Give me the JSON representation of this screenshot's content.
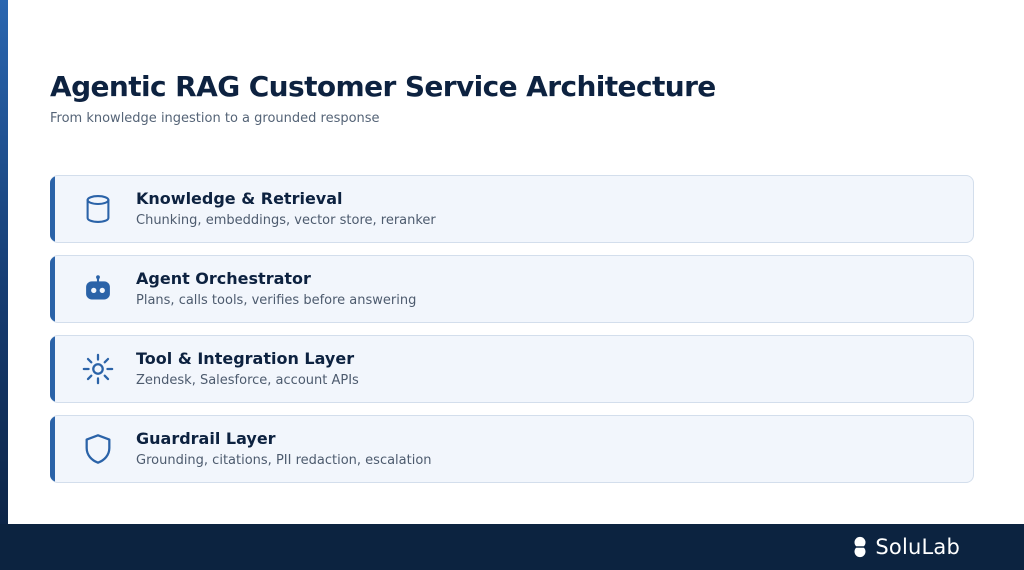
{
  "header": {
    "title": "Agentic RAG Customer Service Architecture",
    "subtitle": "From knowledge ingestion to a grounded response"
  },
  "layers": [
    {
      "title": "Knowledge & Retrieval",
      "description": "Chunking, embeddings, vector store, reranker",
      "icon": "database-icon"
    },
    {
      "title": "Agent Orchestrator",
      "description": "Plans, calls tools, verifies before answering",
      "icon": "robot-icon"
    },
    {
      "title": "Tool & Integration Layer",
      "description": "Zendesk, Salesforce, account APIs",
      "icon": "sun-gear-icon"
    },
    {
      "title": "Guardrail Layer",
      "description": "Grounding, citations, PII redaction, escalation",
      "icon": "shield-icon"
    }
  ],
  "footer": {
    "brand": "SoluLab"
  },
  "colors": {
    "accent": "#2b63a8",
    "title_text": "#0d2240",
    "card_background": "#f2f6fc",
    "footer_background": "#0c2340"
  }
}
